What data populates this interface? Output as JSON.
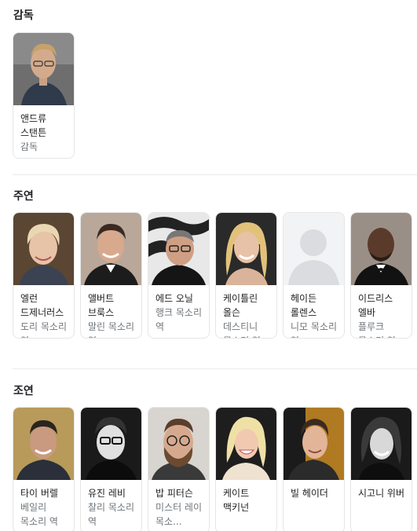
{
  "sections": [
    {
      "title": "감독",
      "people": [
        {
          "name": "앤드류 스탠튼",
          "role": "감독"
        }
      ]
    },
    {
      "title": "주연",
      "people": [
        {
          "name": "엘런 드제너러스",
          "role": "도리 목소리 역"
        },
        {
          "name": "앨버트 브룩스",
          "role": "말린 목소리 역"
        },
        {
          "name": "에드 오닐",
          "role": "행크 목소리 역"
        },
        {
          "name": "케이틀린 올슨",
          "role": "데스티니 목소리 역"
        },
        {
          "name": "헤이든 롤렌스",
          "role": "니모 목소리 역"
        },
        {
          "name": "이드리스 엘바",
          "role": "플루크 목소리 역"
        }
      ]
    },
    {
      "title": "조연",
      "people": [
        {
          "name": "타이 버렐",
          "role": "베일리 목소리 역"
        },
        {
          "name": "유진 레비",
          "role": "찰리 목소리 역"
        },
        {
          "name": "밥 피터슨",
          "role": "미스터 레이 목소..."
        },
        {
          "name": "케이트 맥키넌",
          "role": ""
        },
        {
          "name": "빌 헤이더",
          "role": ""
        },
        {
          "name": "시고니 위버",
          "role": ""
        }
      ]
    }
  ]
}
